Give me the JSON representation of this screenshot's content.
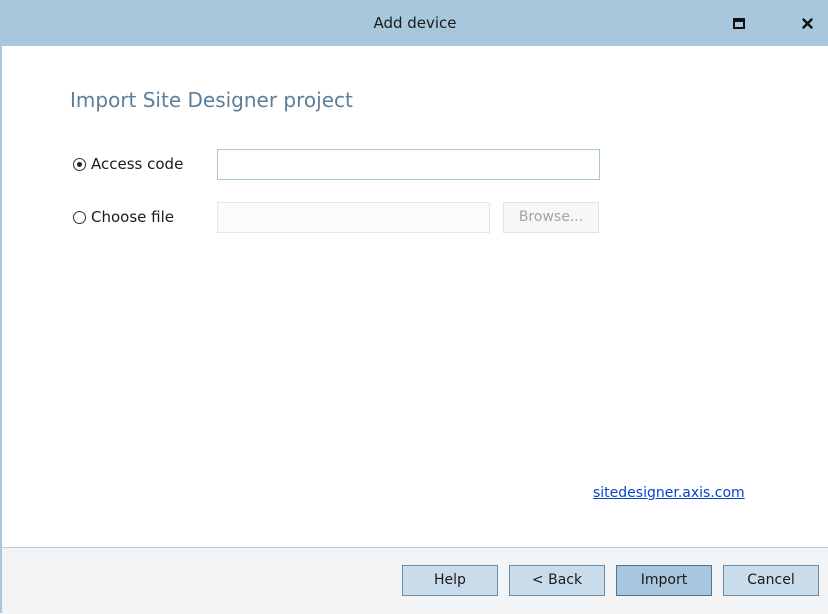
{
  "window": {
    "title": "Add device",
    "maximize_icon": "maximize-icon",
    "close_icon": "close-icon"
  },
  "page": {
    "heading": "Import Site Designer project"
  },
  "options": {
    "access_code": {
      "label": "Access code",
      "selected": true,
      "value": ""
    },
    "choose_file": {
      "label": "Choose file",
      "selected": false,
      "value": "",
      "browse_label": "Browse..."
    }
  },
  "link": {
    "text": "sitedesigner.axis.com"
  },
  "footer": {
    "help_label": "Help",
    "back_label": "< Back",
    "import_label": "Import",
    "cancel_label": "Cancel"
  },
  "colors": {
    "titlebar": "#a7c7dc",
    "heading": "#5c7e99",
    "link": "#0645c8",
    "button": "#c9dceb"
  }
}
